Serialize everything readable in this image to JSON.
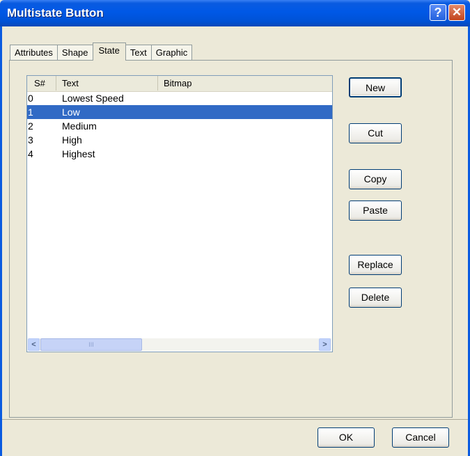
{
  "window": {
    "title": "Multistate Button"
  },
  "tabs": [
    {
      "label": "Attributes"
    },
    {
      "label": "Shape"
    },
    {
      "label": "State"
    },
    {
      "label": "Text"
    },
    {
      "label": "Graphic"
    }
  ],
  "active_tab": "State",
  "list": {
    "columns": [
      "S#",
      "Text",
      "Bitmap"
    ],
    "rows": [
      {
        "sn": "0",
        "text": "Lowest Speed",
        "bitmap": ""
      },
      {
        "sn": "1",
        "text": "Low",
        "bitmap": ""
      },
      {
        "sn": "2",
        "text": "Medium",
        "bitmap": ""
      },
      {
        "sn": "3",
        "text": "High",
        "bitmap": ""
      },
      {
        "sn": "4",
        "text": "Highest",
        "bitmap": ""
      }
    ],
    "selected_row": 1
  },
  "buttons": {
    "new": "New",
    "cut": "Cut",
    "copy": "Copy",
    "paste": "Paste",
    "replace": "Replace",
    "delete": "Delete",
    "ok": "OK",
    "cancel": "Cancel"
  },
  "icons": {
    "help": "?",
    "close": "✕",
    "scroll_left": "<",
    "scroll_right": ">",
    "thumb_grip": "III"
  },
  "colors": {
    "selection": "#316ac5",
    "titlebar": "#0058e6",
    "dialog_bg": "#ece9d8"
  }
}
